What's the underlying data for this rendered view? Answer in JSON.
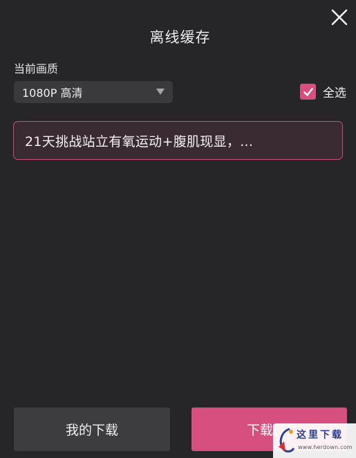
{
  "dialog": {
    "title": "离线缓存",
    "close_icon": "close-icon"
  },
  "quality": {
    "label": "当前画质",
    "selected": "1080P 高清"
  },
  "select_all": {
    "label": "全选",
    "checked": true
  },
  "videos": [
    {
      "title": "21天挑战站立有氧运动+腹肌现显，..."
    }
  ],
  "actions": {
    "my_downloads": "我的下载",
    "download": "下载(1)"
  },
  "watermark": {
    "brand": "这里下载",
    "url": "www.herdown.com"
  },
  "colors": {
    "background": "#262628",
    "accent": "#d64f7f",
    "secondary_button": "#3d3d3f"
  }
}
